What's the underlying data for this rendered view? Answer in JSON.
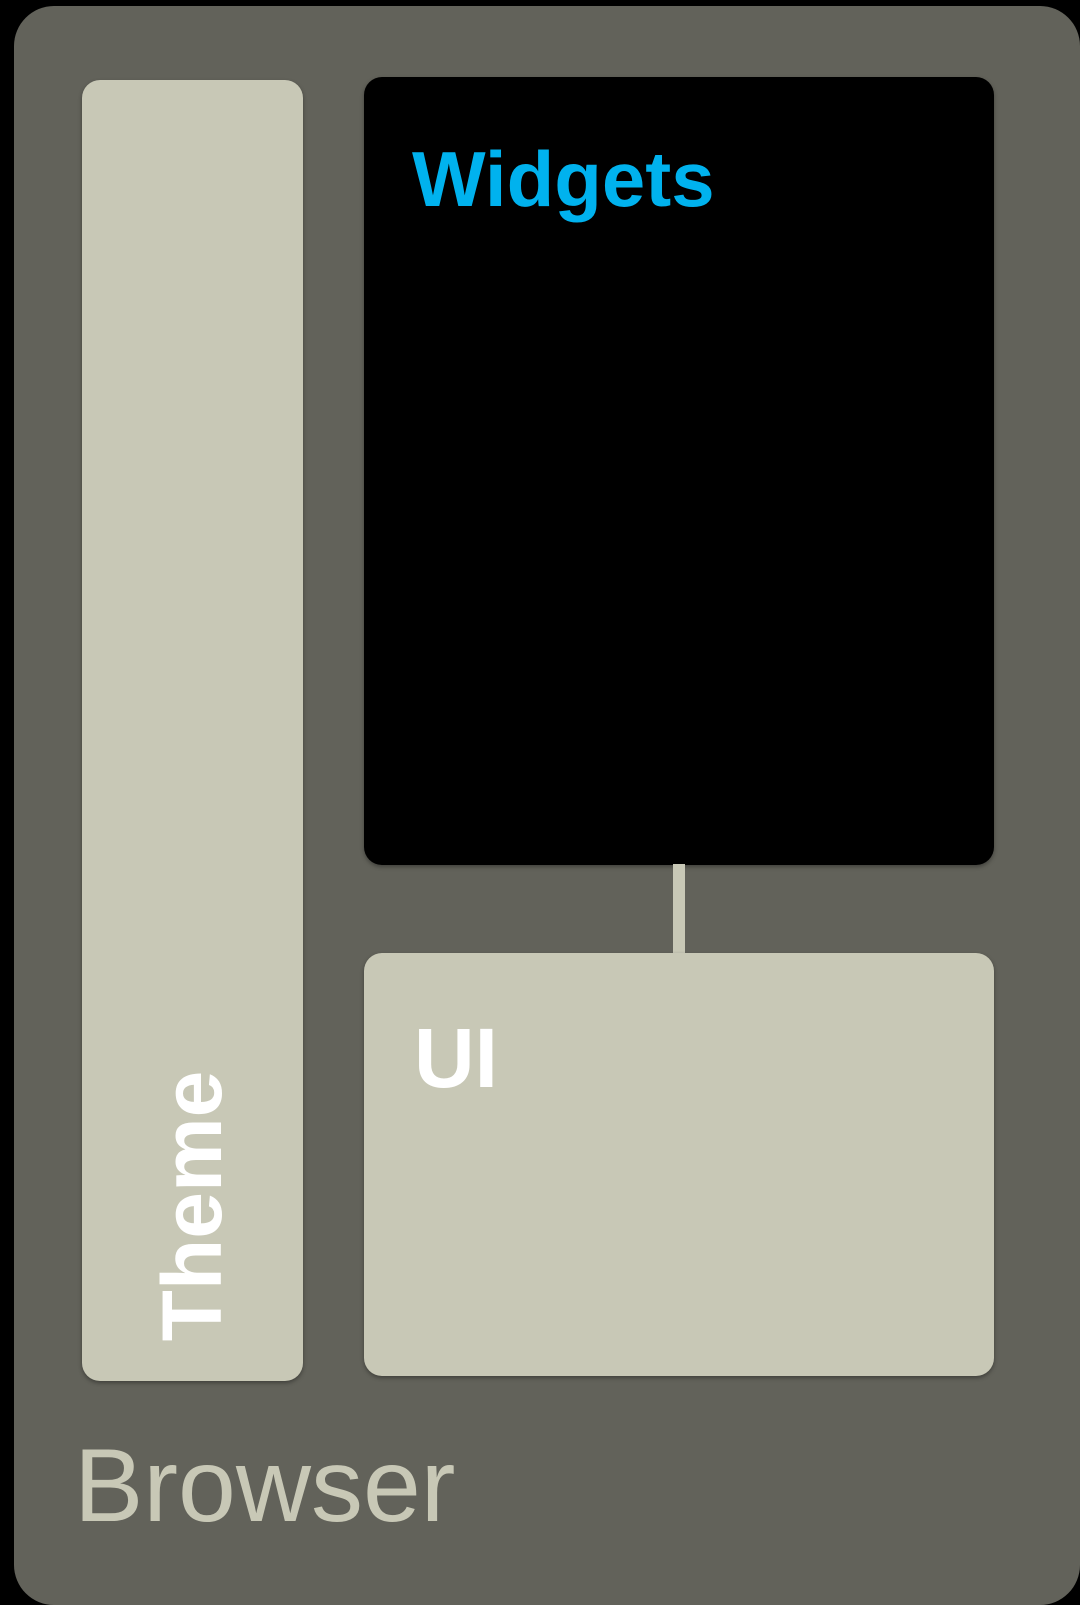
{
  "diagram": {
    "container": {
      "label": "Browser",
      "color": "#62625a"
    },
    "nodes": [
      {
        "id": "theme",
        "label": "Theme",
        "fill": "#c8c8b6",
        "text_color": "#ffffff",
        "orientation": "vertical"
      },
      {
        "id": "widgets",
        "label": "Widgets",
        "fill": "#000000",
        "text_color": "#00b2ee"
      },
      {
        "id": "ui",
        "label": "UI",
        "fill": "#c8c8b6",
        "text_color": "#ffffff"
      }
    ],
    "edges": [
      {
        "from": "widgets",
        "to": "ui"
      }
    ]
  }
}
